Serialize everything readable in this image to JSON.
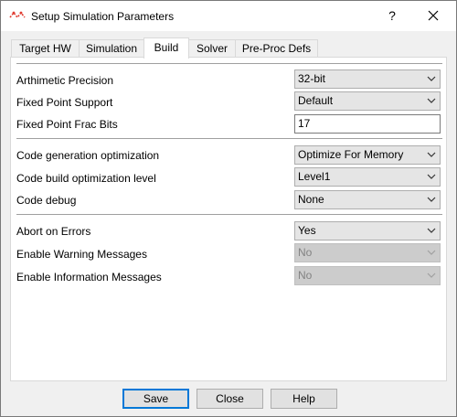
{
  "window": {
    "title": "Setup Simulation Parameters",
    "help_label": "?",
    "icons": {
      "app": "simulation-app-icon",
      "close": "close-icon"
    }
  },
  "tabs": [
    {
      "label": "Target HW",
      "active": false
    },
    {
      "label": "Simulation",
      "active": false
    },
    {
      "label": "Build",
      "active": true
    },
    {
      "label": "Solver",
      "active": false
    },
    {
      "label": "Pre-Proc Defs",
      "active": false
    }
  ],
  "settings": {
    "precision": {
      "label": "Arthimetic Precision",
      "value": "32-bit"
    },
    "fixed_point": {
      "label": "Fixed Point Support",
      "value": "Default"
    },
    "frac_bits": {
      "label": "Fixed Point Frac Bits",
      "value": "17"
    },
    "codegen_opt": {
      "label": "Code generation optimization",
      "value": "Optimize For Memory"
    },
    "build_opt": {
      "label": "Code build optimization level",
      "value": "Level1"
    },
    "debug": {
      "label": "Code debug",
      "value": "None"
    },
    "abort": {
      "label": "Abort on Errors",
      "value": "Yes"
    },
    "warnings": {
      "label": "Enable Warning Messages",
      "value": "No",
      "enabled": false
    },
    "info": {
      "label": "Enable Information Messages",
      "value": "No",
      "enabled": false
    }
  },
  "buttons": {
    "save": "Save",
    "close": "Close",
    "help": "Help"
  },
  "colors": {
    "accent": "#0078d7",
    "icon_red": "#e03c31"
  }
}
